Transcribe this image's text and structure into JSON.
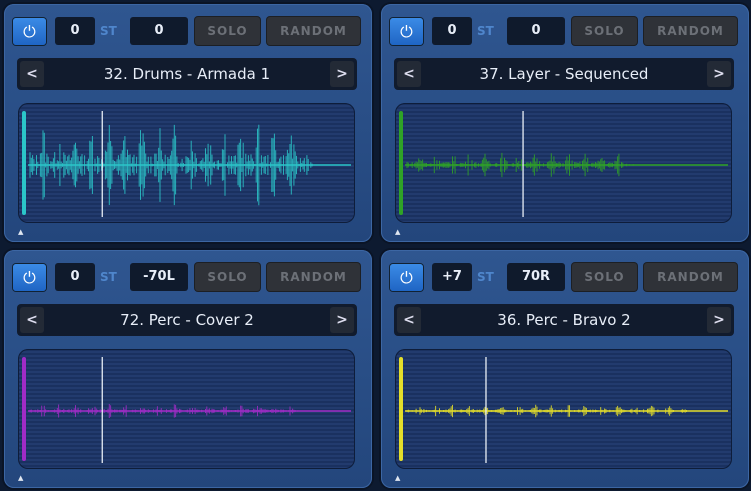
{
  "common": {
    "st_label": "ST",
    "solo_label": "SOLO",
    "random_label": "RANDOM",
    "prev_label": "<",
    "next_label": ">",
    "marker": "▲",
    "power_icon": "⏻"
  },
  "slots": [
    {
      "tune": "0",
      "pan": "0",
      "name": "32. Drums - Armada 1",
      "color": "#2bc6c9",
      "amplitude": 0.85,
      "playhead": 0.25,
      "tail_end": 0.88
    },
    {
      "tune": "0",
      "pan": "0",
      "name": "37. Layer - Sequenced",
      "color": "#2fa326",
      "amplitude": 0.25,
      "playhead": 0.38,
      "tail_end": 0.72
    },
    {
      "tune": "0",
      "pan": "-70L",
      "name": "72. Perc - Cover 2",
      "color": "#a02cc6",
      "amplitude": 0.14,
      "playhead": 0.25,
      "tail_end": 0.85
    },
    {
      "tune": "+7",
      "pan": "70R",
      "name": "36. Perc - Bravo 2",
      "color": "#e3de2a",
      "amplitude": 0.12,
      "playhead": 0.27,
      "tail_end": 0.88
    }
  ]
}
